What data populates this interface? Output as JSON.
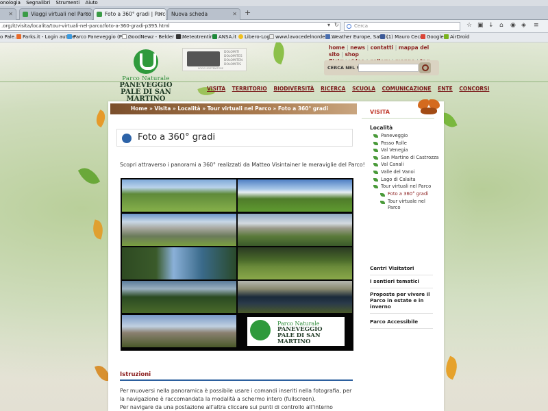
{
  "browser": {
    "menu": [
      "onologia",
      "Segnalibri",
      "Strumenti",
      "Aiuto"
    ],
    "tabs": [
      {
        "label": "Viaggi virtuali nel Parco | P..."
      },
      {
        "label": "Foto a 360° gradi | Parco P..."
      },
      {
        "label": "Nuova scheda"
      }
    ],
    "url": ".org/it/visita/localita/tour-virtuali-nel-parco/foto-a-360-gradi-p395.html",
    "search_placeholder": "Cerca",
    "bookmarks": [
      "o Pale...",
      "Parks.it - Login autore",
      "Parco Paneveggio (Par...",
      "GoodNewz - Belder Int...",
      "Meteotrentino",
      "ANSA.it",
      "Libero-Login",
      "www.lavocedelnordest....",
      "Weather Europe, Satell...",
      "(1) Mauro Cecco",
      "Google",
      "AirDroid"
    ]
  },
  "header": {
    "logo_line1": "Parco Naturale",
    "logo_line2": "PANEVEGGIO",
    "logo_line3": "PALE DI SAN MARTINO",
    "dolomiti_text": "DOLOMITI DOLOMITES DOLOMITEN DOLOMITIS",
    "dolomiti_sub": "SOCIO SOSTENITORE",
    "toplinks_row1": [
      "home",
      "news",
      "contatti",
      "mappa del sito",
      "shop"
    ],
    "toplinks_row2": [
      "flickr",
      "video",
      "gallery",
      "mappe",
      "tag"
    ],
    "search_label": "CERCA NEL SITO",
    "nav": [
      "VISITA",
      "TERRITORIO",
      "BIODIVERSITÀ",
      "RICERCA",
      "SCUOLA",
      "COMUNICAZIONE",
      "ENTE",
      "CONCORSI"
    ]
  },
  "content": {
    "breadcrumb": "Home » Visita » Località » Tour virtuali nel Parco » Foto a 360° gradi",
    "title": "Foto a 360° gradi",
    "intro": "Scopri attraverso i panorami a 360° realizzati da Matteo Visintainer le meraviglie del Parco!",
    "logo_tile_line1": "Parco Naturale",
    "logo_tile_line2": "PANEVEGGIO",
    "logo_tile_line3": "PALE DI SAN MARTINO",
    "istruzioni_title": "Istruzioni",
    "istruzioni_text": "Per muoversi nella panoramica è possibile usare i comandi inseriti nella fotografia, per la navigazione è raccomandata la modalità a schermo intero (fullscreen).",
    "istruzioni_text2": "Per navigare da una postazione all'altra cliccare sui punti di controllo all'interno dell'immagine (i"
  },
  "sidebar": {
    "heading": "VISITA",
    "localita": "Località",
    "items": [
      "Paneveggio",
      "Passo Rolle",
      "Val Venegia",
      "San Martino di Castrozza",
      "Val Canali",
      "Valle del Vanoi",
      "Lago di Calaita",
      "Tour virtuali nel Parco"
    ],
    "sub_items": [
      "Foto a 360° gradi",
      "Tour virtuale nel Parco"
    ],
    "sections": [
      "Centri Visitatori",
      "I sentieri tematici",
      "Proposte per vivere il Parco in estate e in inverno",
      "Parco Accessibile"
    ]
  }
}
